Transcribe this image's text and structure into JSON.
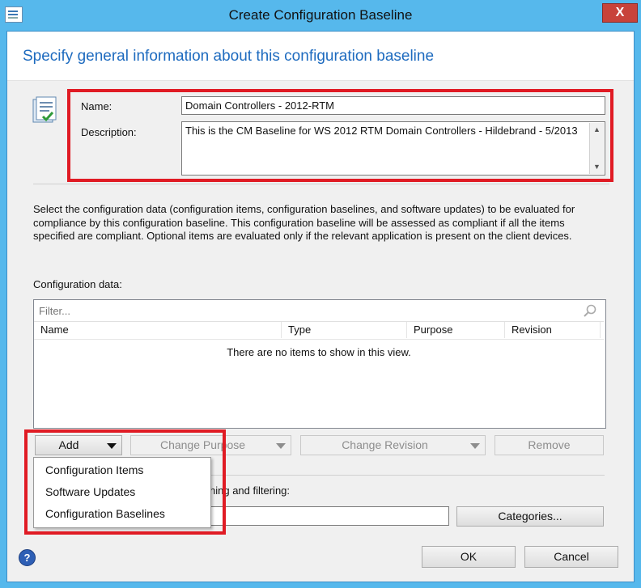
{
  "window": {
    "title": "Create Configuration Baseline",
    "close_label": "X"
  },
  "heading": "Specify general information about this configuration baseline",
  "form": {
    "name_label": "Name:",
    "name_value": "Domain Controllers - 2012-RTM",
    "description_label": "Description:",
    "description_value": "This is the CM Baseline for WS 2012 RTM Domain Controllers - Hildebrand - 5/2013"
  },
  "info_text": [
    "Select the configuration data (configuration items, configuration baselines, and software updates) to be evaluated for",
    "compliance by this configuration baseline. This configuration baseline will be assessed as compliant if all the items",
    "specified are compliant. Optional items are evaluated only if the relevant application is present on  the client devices."
  ],
  "config_data": {
    "label": "Configuration data:",
    "filter_placeholder": "Filter...",
    "columns": [
      "Name",
      "Type",
      "Purpose",
      "Revision"
    ],
    "empty_message": "There are no items to show in this view."
  },
  "buttons": {
    "add": "Add",
    "change_purpose": "Change Purpose",
    "change_revision": "Change Revision",
    "remove": "Remove",
    "categories": "Categories...",
    "ok": "OK",
    "cancel": "Cancel"
  },
  "add_menu": [
    "Configuration Items",
    "Software Updates",
    "Configuration Baselines"
  ],
  "categories_label_visible": "hing and filtering:",
  "help_label": "?",
  "colors": {
    "heading": "#1e6bbf",
    "highlight_box": "#e01b24",
    "window_frame": "#56b8ec",
    "close_button": "#c8433a"
  }
}
